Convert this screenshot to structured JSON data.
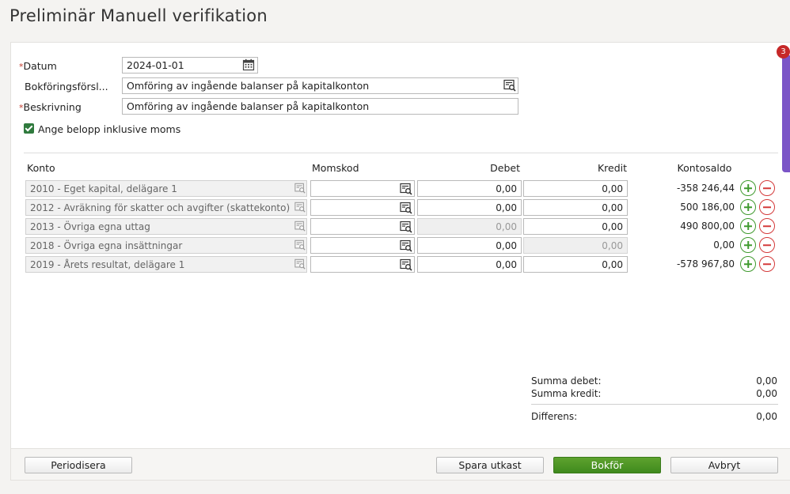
{
  "page": {
    "title": "Preliminär Manuell verifikation"
  },
  "form": {
    "datum_label": "Datum",
    "datum_value": "2024-01-01",
    "forslag_label": "Bokföringsförsl...",
    "forslag_value": "Omföring av ingående balanser på kapitalkonton",
    "beskrivning_label": "Beskrivning",
    "beskrivning_value": "Omföring av ingående balanser på kapitalkonton",
    "moms_checkbox_label": "Ange belopp inklusive moms",
    "moms_checkbox_checked": true,
    "required_marker": "*"
  },
  "table": {
    "headers": {
      "konto": "Konto",
      "momskod": "Momskod",
      "debet": "Debet",
      "kredit": "Kredit",
      "kontosaldo": "Kontosaldo"
    },
    "rows": [
      {
        "konto": "2010 - Eget kapital, delägare 1",
        "debet": "0,00",
        "kredit": "0,00",
        "saldo": "-358 246,44",
        "debet_disabled": false,
        "kredit_disabled": false
      },
      {
        "konto": "2012 - Avräkning för skatter och avgifter (skattekonto)",
        "debet": "0,00",
        "kredit": "0,00",
        "saldo": "500 186,00",
        "debet_disabled": false,
        "kredit_disabled": false
      },
      {
        "konto": "2013 - Övriga egna uttag",
        "debet": "0,00",
        "kredit": "0,00",
        "saldo": "490 800,00",
        "debet_disabled": true,
        "kredit_disabled": false
      },
      {
        "konto": "2018 - Övriga egna insättningar",
        "debet": "0,00",
        "kredit": "0,00",
        "saldo": "0,00",
        "debet_disabled": false,
        "kredit_disabled": true
      },
      {
        "konto": "2019 - Årets resultat, delägare 1",
        "debet": "0,00",
        "kredit": "0,00",
        "saldo": "-578 967,80",
        "debet_disabled": false,
        "kredit_disabled": false
      }
    ]
  },
  "summary": {
    "summa_debet_label": "Summa debet:",
    "summa_debet_value": "0,00",
    "summa_kredit_label": "Summa kredit:",
    "summa_kredit_value": "0,00",
    "differens_label": "Differens:",
    "differens_value": "0,00"
  },
  "footer": {
    "periodisera": "Periodisera",
    "spara_utkast": "Spara utkast",
    "bokfor": "Bokför",
    "avbryt": "Avbryt"
  },
  "notifications": {
    "count": "3"
  },
  "colors": {
    "accent_green": "#4c9626",
    "side_tab": "#7b55c7",
    "badge": "#c62828",
    "required": "#c0392b"
  },
  "icons": {
    "calendar": "calendar-icon",
    "lookup": "lookup-search-icon",
    "add": "add-row-icon",
    "remove": "remove-row-icon"
  }
}
